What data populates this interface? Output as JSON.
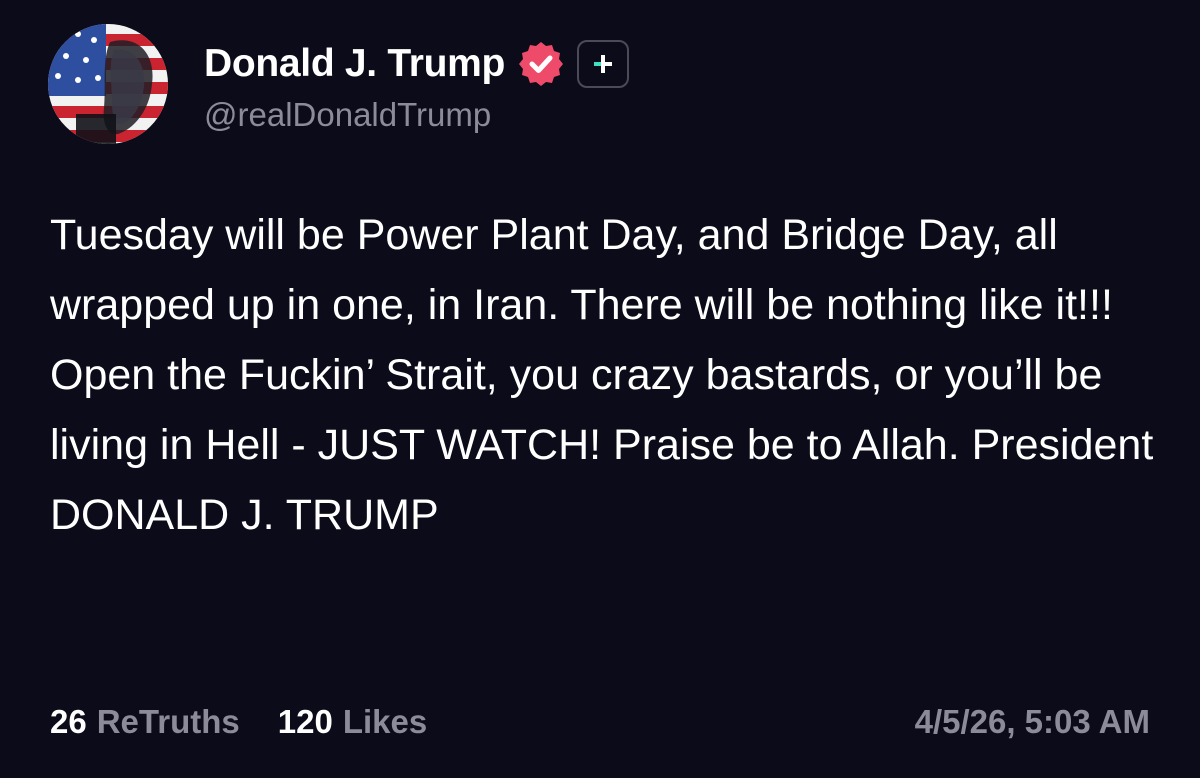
{
  "author": {
    "display_name": "Donald J. Trump",
    "handle": "@realDonaldTrump",
    "avatar_icon": "flag-portrait-avatar",
    "verified_icon": "verified-check-icon",
    "plus_icon": "add-plus-icon",
    "verified_color": "#ee4b6a",
    "plus_color": "#3fe0c4"
  },
  "post": {
    "text": "Tuesday will be Power Plant Day, and Bridge Day, all wrapped up in one, in Iran. There will be nothing like it!!! Open the Fuckin’ Strait, you crazy bastards, or you’ll be living in Hell - JUST WATCH! Praise be to Allah. President DONALD J. TRUMP"
  },
  "stats": {
    "retruths_count": "26",
    "retruths_label": "ReTruths",
    "likes_count": "120",
    "likes_label": "Likes",
    "timestamp": "4/5/26, 5:03 AM"
  }
}
